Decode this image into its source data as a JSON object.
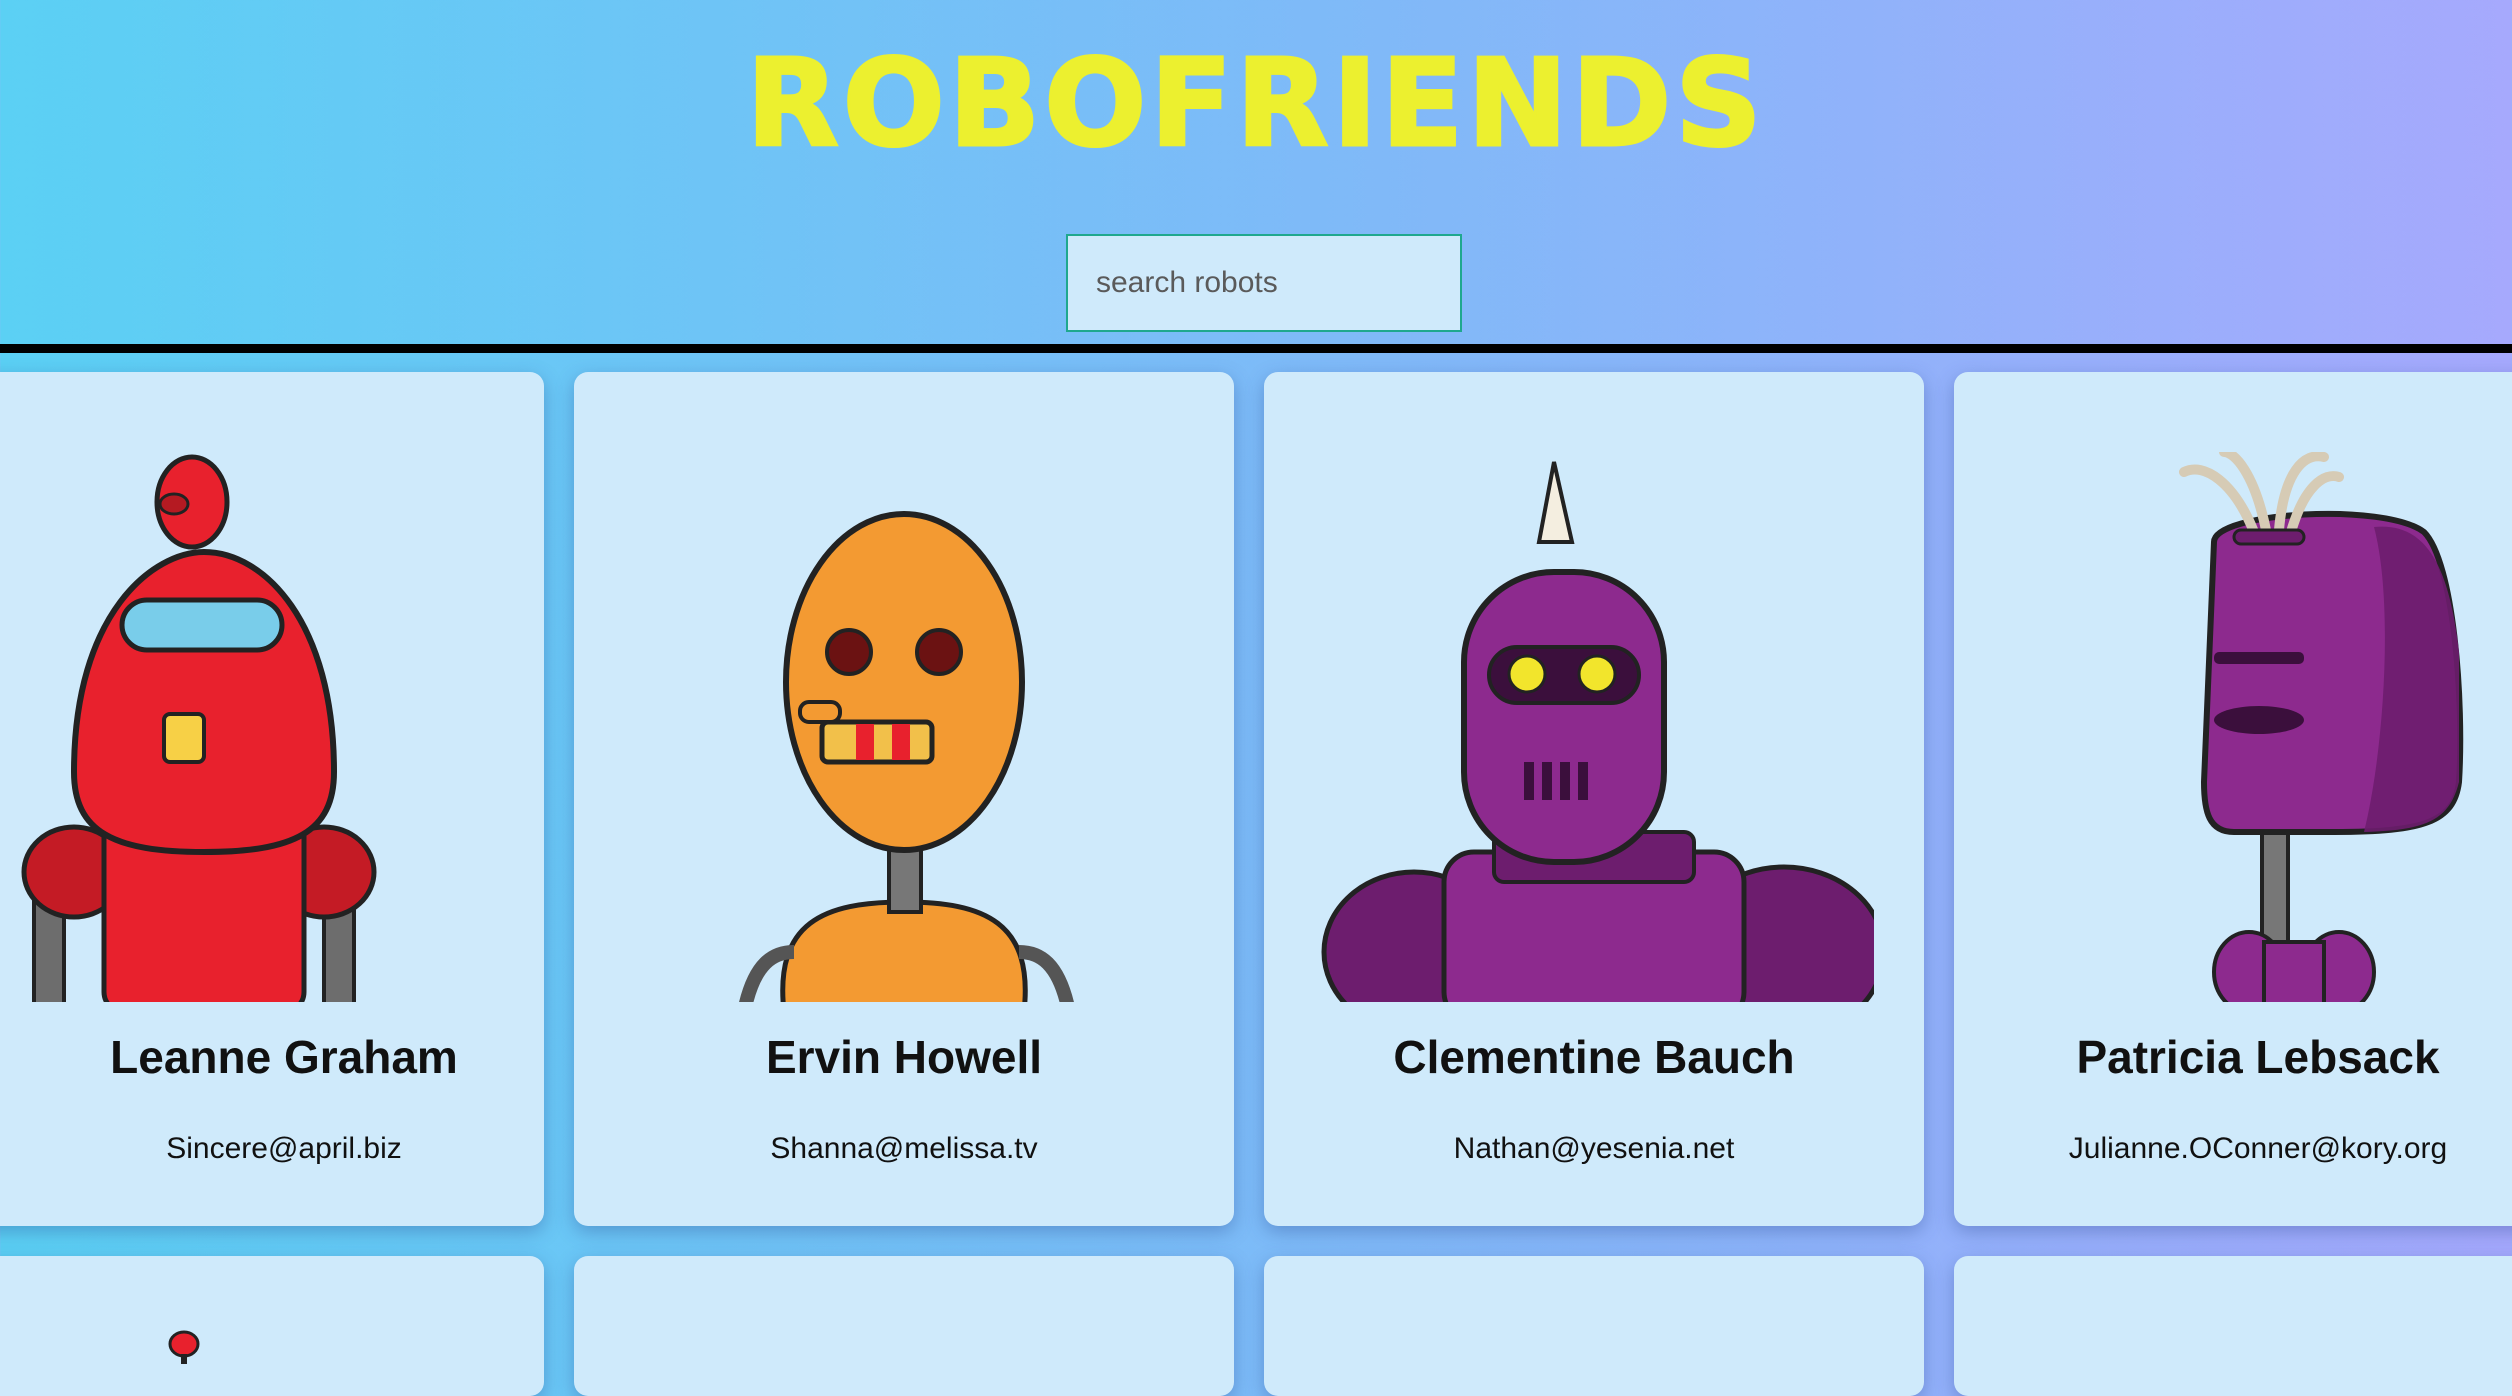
{
  "app": {
    "title": "ROBOFRIENDS"
  },
  "search": {
    "placeholder": "search robots",
    "value": ""
  },
  "robots": [
    {
      "name": "Leanne Graham",
      "email": "Sincere@april.biz",
      "color": "#e8212d"
    },
    {
      "name": "Ervin Howell",
      "email": "Shanna@melissa.tv",
      "color": "#f39a32"
    },
    {
      "name": "Clementine Bauch",
      "email": "Nathan@yesenia.net",
      "color": "#8d2a8e"
    },
    {
      "name": "Patricia Lebsack",
      "email": "Julianne.OConner@kory.org",
      "color": "#8d2a8e"
    }
  ],
  "colors": {
    "title": "#ecf02f",
    "card_background": "#cfeafb",
    "divider": "#000000",
    "search_border": "#1fa88e"
  }
}
